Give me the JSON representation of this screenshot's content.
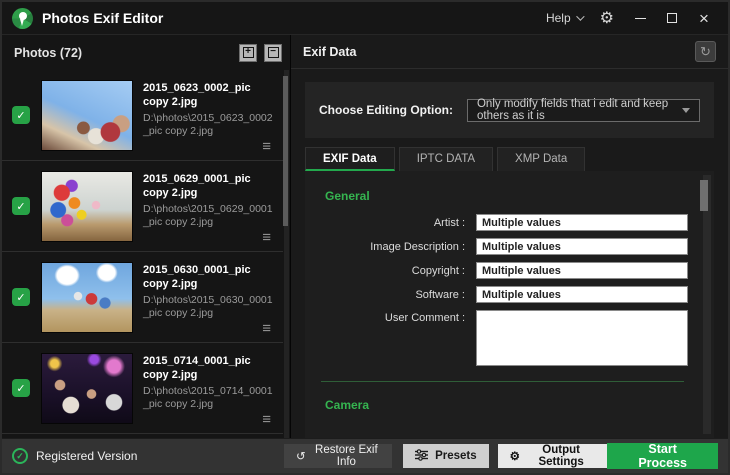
{
  "colors": {
    "accent_green": "#23a94d",
    "checkbox_green": "#27a246",
    "section_title_green": "#35b450",
    "start_button_green": "#1ea64b"
  },
  "icons": {
    "gear": "⚙",
    "close": "×",
    "refresh": "↻",
    "restore": "↺",
    "check": "✓",
    "menu": "≡",
    "plus": "+",
    "minus": "−"
  },
  "window": {
    "title": "Photos Exif Editor",
    "help_label": "Help"
  },
  "photos_panel": {
    "header": "Photos (72)",
    "items": [
      {
        "filename": "2015_0623_0002_pic copy 2.jpg",
        "path": "D:\\photos\\2015_0623_0002_pic copy 2.jpg",
        "thumb": "selfie-sky",
        "checked": true
      },
      {
        "filename": "2015_0629_0001_pic copy 2.jpg",
        "path": "D:\\photos\\2015_0629_0001_pic copy 2.jpg",
        "thumb": "balloons-pier",
        "checked": true
      },
      {
        "filename": "2015_0630_0001_pic copy 2.jpg",
        "path": "D:\\photos\\2015_0630_0001_pic copy 2.jpg",
        "thumb": "street-dance",
        "checked": true
      },
      {
        "filename": "2015_0714_0001_pic copy 2.jpg",
        "path": "D:\\photos\\2015_0714_0001_pic copy 2.jpg",
        "thumb": "party-night",
        "checked": true
      }
    ]
  },
  "exif_panel": {
    "header": "Exif Data",
    "editing_option_label": "Choose Editing Option:",
    "editing_option_value": "Only modify fields that i edit and keep others as it is",
    "tabs": [
      {
        "label": "EXIF Data",
        "active": true
      },
      {
        "label": "IPTC DATA",
        "active": false
      },
      {
        "label": "XMP Data",
        "active": false
      }
    ],
    "sections": {
      "general": {
        "title": "General",
        "fields": [
          {
            "label": "Artist :",
            "value": "Multiple values",
            "type": "input"
          },
          {
            "label": "Image Description :",
            "value": "Multiple values",
            "type": "input"
          },
          {
            "label": "Copyright :",
            "value": "Multiple values",
            "type": "input"
          },
          {
            "label": "Software :",
            "value": "Multiple values",
            "type": "input"
          },
          {
            "label": "User Comment :",
            "value": "",
            "type": "textarea"
          }
        ]
      },
      "camera": {
        "title": "Camera"
      }
    }
  },
  "footer": {
    "registered_label": "Registered Version",
    "restore_button": "Restore Exif Info",
    "presets_button": "Presets",
    "output_settings_button": "Output Settings",
    "start_button": "Start Process"
  }
}
